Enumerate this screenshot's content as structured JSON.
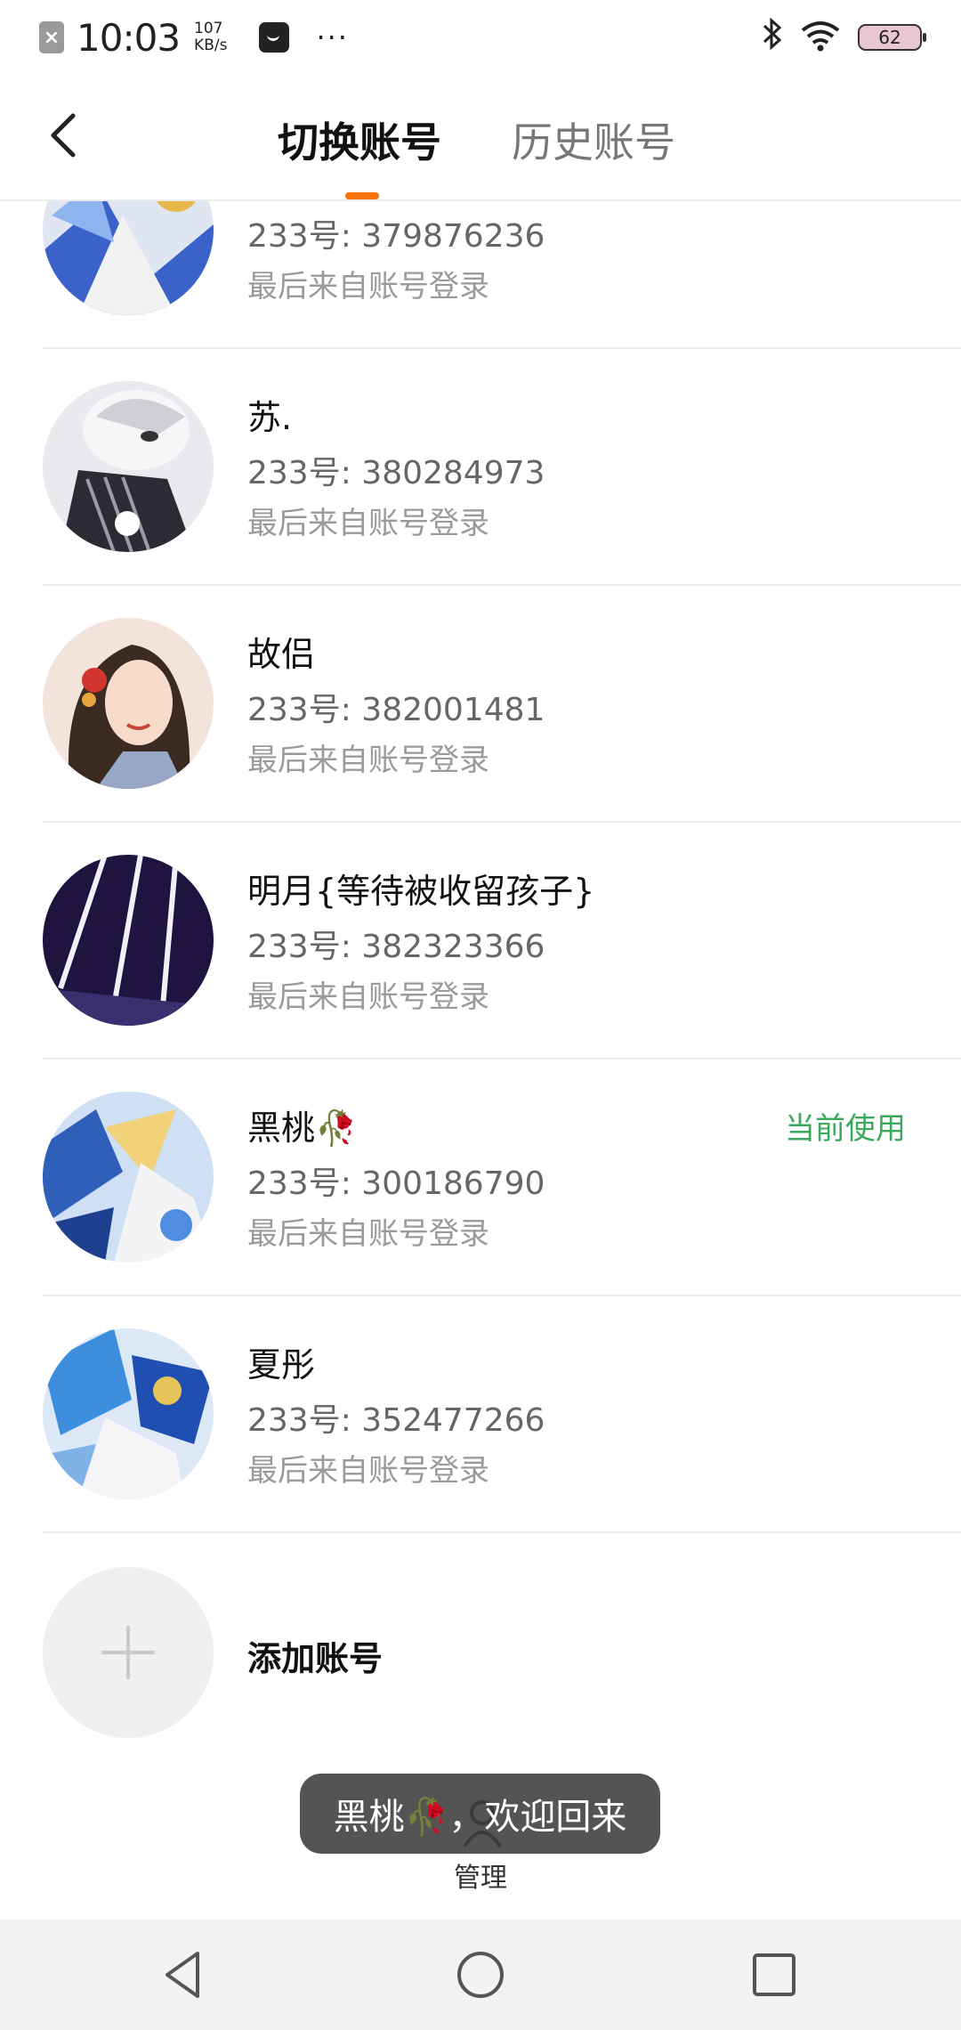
{
  "status_bar": {
    "time": "10:03",
    "speed_value": "107",
    "speed_unit": "KB/s",
    "more": "···",
    "battery": "62"
  },
  "header": {
    "tabs": [
      {
        "label": "切换账号",
        "active": true
      },
      {
        "label": "历史账号",
        "active": false
      }
    ],
    "accent_color": "#f4730d"
  },
  "accounts": [
    {
      "name": "",
      "id": "233号: 379876236",
      "sub": "最后来自账号登录",
      "current": ""
    },
    {
      "name": "苏.",
      "id": "233号: 380284973",
      "sub": "最后来自账号登录",
      "current": ""
    },
    {
      "name": "故侣",
      "id": "233号: 382001481",
      "sub": "最后来自账号登录",
      "current": ""
    },
    {
      "name": "明月{等待被收留孩子}",
      "id": "233号: 382323366",
      "sub": "最后来自账号登录",
      "current": ""
    },
    {
      "name": "黑桃🥀",
      "id": "233号: 300186790",
      "sub": "最后来自账号登录",
      "current": "当前使用"
    },
    {
      "name": "夏彤",
      "id": "233号: 352477266",
      "sub": "最后来自账号登录",
      "current": ""
    }
  ],
  "add_account": {
    "label": "添加账号"
  },
  "toast": {
    "text": "黑桃🥀，欢迎回来"
  },
  "manage": {
    "label": "管理"
  },
  "colors": {
    "current_label": "#3ba95b"
  }
}
